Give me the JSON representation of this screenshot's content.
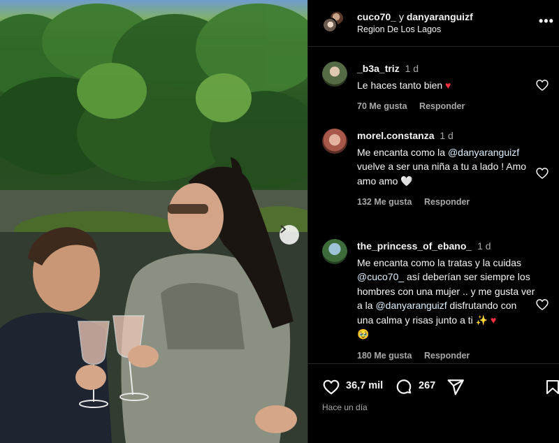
{
  "post": {
    "authors": {
      "user1": "cuco70_",
      "connector": "y",
      "user2": "danyaranguizf"
    },
    "location": "Region De Los Lagos",
    "more_icon": "more-horizontal-icon"
  },
  "comments": [
    {
      "username": "_b3a_triz",
      "time": "1 d",
      "text": "Le haces tanto bien",
      "emoji": "♥",
      "likes": "70 Me gusta",
      "reply": "Responder"
    },
    {
      "username": "morel.constanza",
      "time": "1 d",
      "text_before": "Me encanta como la",
      "mention": "@danyaranguizf",
      "text_after": "vuelve a ser una niña a tu a lado ! Amo amo amo",
      "emoji": "🤍",
      "likes": "132 Me gusta",
      "reply": "Responder"
    },
    {
      "username": "the_princess_of_ebano_",
      "time": "1 d",
      "text_before": "Me encanta como la tratas y la cuidas",
      "mention1": "@cuco70_",
      "text_middle": "así deberían ser siempre los hombres con una mujer .. y me gusta ver a la",
      "mention2": "@danyaranguizf",
      "text_after": "disfrutando con una calma y risas junto a ti",
      "emoji": "✨ ♥",
      "emoji2": "🥹",
      "likes": "180 Me gusta",
      "reply": "Responder"
    }
  ],
  "actions": {
    "likes": "36,7 mil",
    "comments": "267",
    "posted": "Hace un día"
  },
  "colors": {
    "background": "#000000",
    "text": "#f5f5f5",
    "muted": "#a8a8a8",
    "heart": "#ff3040",
    "mention": "#e0f1ff"
  }
}
